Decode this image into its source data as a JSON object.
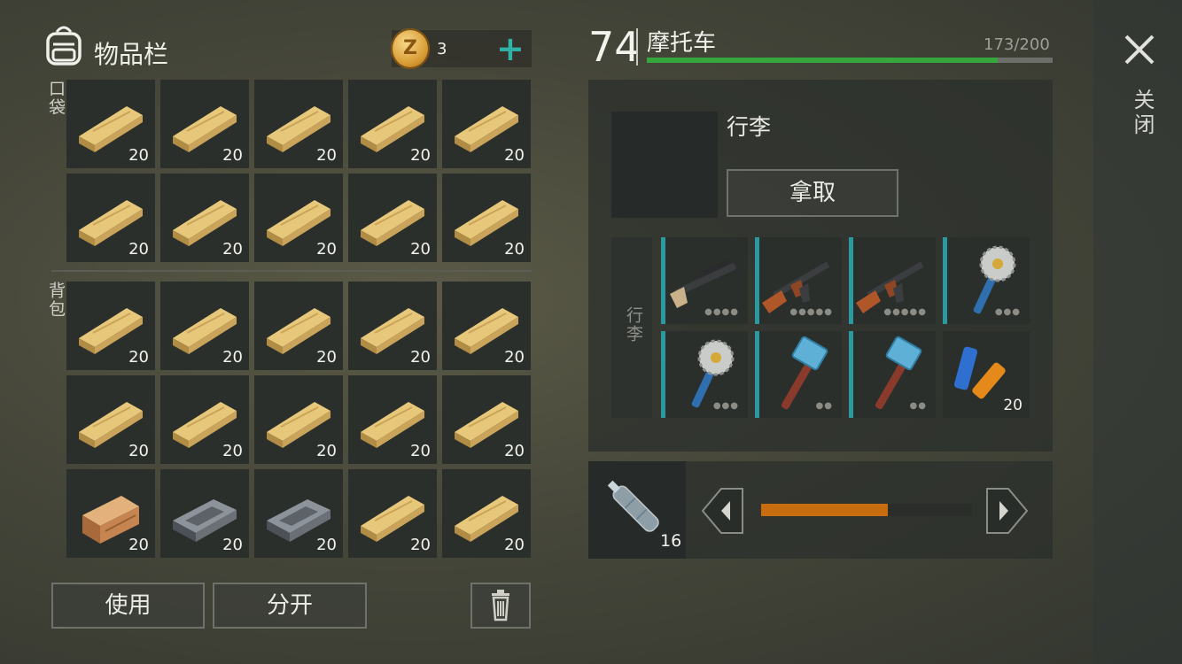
{
  "inventory": {
    "title": "物品栏",
    "coins": "3",
    "pocket_label": "口袋",
    "backpack_label": "背包",
    "pocket_items": [
      {
        "type": "plank",
        "qty": "20"
      },
      {
        "type": "plank",
        "qty": "20"
      },
      {
        "type": "plank",
        "qty": "20"
      },
      {
        "type": "plank",
        "qty": "20"
      },
      {
        "type": "plank",
        "qty": "20"
      },
      {
        "type": "plank",
        "qty": "20"
      },
      {
        "type": "plank",
        "qty": "20"
      },
      {
        "type": "plank",
        "qty": "20"
      },
      {
        "type": "plank",
        "qty": "20"
      },
      {
        "type": "plank",
        "qty": "20"
      }
    ],
    "backpack_items": [
      {
        "type": "plank",
        "qty": "20"
      },
      {
        "type": "plank",
        "qty": "20"
      },
      {
        "type": "plank",
        "qty": "20"
      },
      {
        "type": "plank",
        "qty": "20"
      },
      {
        "type": "plank",
        "qty": "20"
      },
      {
        "type": "plank",
        "qty": "20"
      },
      {
        "type": "plank",
        "qty": "20"
      },
      {
        "type": "plank",
        "qty": "20"
      },
      {
        "type": "plank",
        "qty": "20"
      },
      {
        "type": "plank",
        "qty": "20"
      },
      {
        "type": "log",
        "qty": "20"
      },
      {
        "type": "iron",
        "qty": "20"
      },
      {
        "type": "iron",
        "qty": "20"
      },
      {
        "type": "plank",
        "qty": "20"
      },
      {
        "type": "plank",
        "qty": "20"
      }
    ],
    "use_label": "使用",
    "split_label": "分开"
  },
  "vehicle": {
    "level": "74",
    "name": "摩托车",
    "hp_text": "173/200",
    "hp_fraction": 0.865,
    "luggage_title": "行李",
    "take_label": "拿取",
    "tab_label": "行李",
    "items": [
      {
        "type": "shotgun",
        "dots": "●●●●",
        "qty": ""
      },
      {
        "type": "rifle",
        "dots": "●●●●●",
        "qty": ""
      },
      {
        "type": "rifle",
        "dots": "●●●●●",
        "qty": ""
      },
      {
        "type": "saw-mace",
        "dots": "●●●",
        "qty": ""
      },
      {
        "type": "saw-mace",
        "dots": "●●●",
        "qty": ""
      },
      {
        "type": "hammer",
        "dots": "●●",
        "qty": ""
      },
      {
        "type": "hammer",
        "dots": "●●",
        "qty": ""
      },
      {
        "type": "batteries",
        "dots": "",
        "qty": "20"
      }
    ]
  },
  "fuel": {
    "item": "bottle",
    "qty": "16",
    "fraction": 0.6
  },
  "close_label": "关闭",
  "colors": {
    "accent": "#2fb3a6",
    "hp": "#35a73d",
    "fuel": "#c86c10"
  }
}
